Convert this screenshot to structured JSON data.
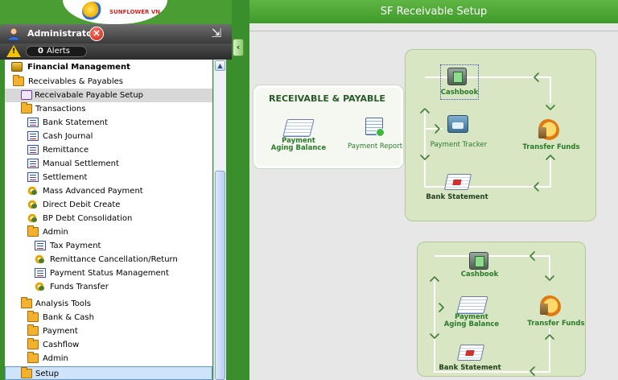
{
  "app": {
    "logo_text": "SUNFLOWER VN",
    "page_title": "SF Receivable Setup"
  },
  "user": {
    "name": "Administrator",
    "alerts_count": "0",
    "alerts_label": "Alerts"
  },
  "tree": {
    "items": [
      {
        "label": "Financial Management",
        "icon": "coins-icon",
        "level": 0,
        "bold": true
      },
      {
        "label": "Receivables & Payables",
        "icon": "folder-icon",
        "level": 1
      },
      {
        "label": "Receivabale Payable Setup",
        "icon": "hierarchy-icon",
        "level": 2,
        "selected": true
      },
      {
        "label": "Transactions",
        "icon": "folder-icon",
        "level": 2
      },
      {
        "label": "Bank Statement",
        "icon": "document-icon",
        "level": 3
      },
      {
        "label": "Cash Journal",
        "icon": "document-icon",
        "level": 3
      },
      {
        "label": "Remittance",
        "icon": "document-icon",
        "level": 3
      },
      {
        "label": "Manual Settlement",
        "icon": "document-icon",
        "level": 3
      },
      {
        "label": "Settlement",
        "icon": "document-icon",
        "level": 3
      },
      {
        "label": "Mass Advanced Payment",
        "icon": "gear-icon",
        "level": 3
      },
      {
        "label": "Direct Debit Create",
        "icon": "gear-icon",
        "level": 3
      },
      {
        "label": "BP Debt Consolidation",
        "icon": "gear-icon",
        "level": 3
      },
      {
        "label": "Admin",
        "icon": "folder-icon",
        "level": 3
      },
      {
        "label": "Tax Payment",
        "icon": "document-icon",
        "level": 4
      },
      {
        "label": "Remittance Cancellation/Return",
        "icon": "gear-icon",
        "level": 4
      },
      {
        "label": "Payment Status Management",
        "icon": "document-icon",
        "level": 4
      },
      {
        "label": "Funds Transfer",
        "icon": "gear-icon",
        "level": 4
      },
      {
        "label": "Analysis Tools",
        "icon": "folder-icon",
        "level": 2
      },
      {
        "label": "Bank & Cash",
        "icon": "folder-icon",
        "level": 3
      },
      {
        "label": "Payment",
        "icon": "folder-icon",
        "level": 3
      },
      {
        "label": "Cashflow",
        "icon": "folder-icon",
        "level": 3
      },
      {
        "label": "Admin",
        "icon": "folder-icon",
        "level": 3
      },
      {
        "label": "Setup",
        "icon": "folder-icon",
        "level": 2,
        "highlight": true
      }
    ]
  },
  "diagram": {
    "section_title": "RECEIVABLE & PAYABLE",
    "top": {
      "payment_aging_line1": "Payment",
      "payment_aging_line2": "Aging Balance",
      "payment_report": "Payment Report",
      "cashbook": "Cashbook",
      "payment_tracker": "Payment Tracker",
      "transfer_funds": "Transfer Funds",
      "bank_statement": "Bank Statement"
    },
    "bottom": {
      "cashbook": "Cashbook",
      "payment_aging_line1": "Payment",
      "payment_aging_line2": "Aging Balance",
      "transfer_funds": "Transfer Funds",
      "bank_statement": "Bank Statement"
    }
  },
  "colors": {
    "accent_green": "#3a8f2c",
    "panel_green": "#d8e6c4",
    "label_green": "#2a7a2a",
    "selected_row": "#d8d8d8",
    "setup_highlight": "#cfe4fb"
  }
}
